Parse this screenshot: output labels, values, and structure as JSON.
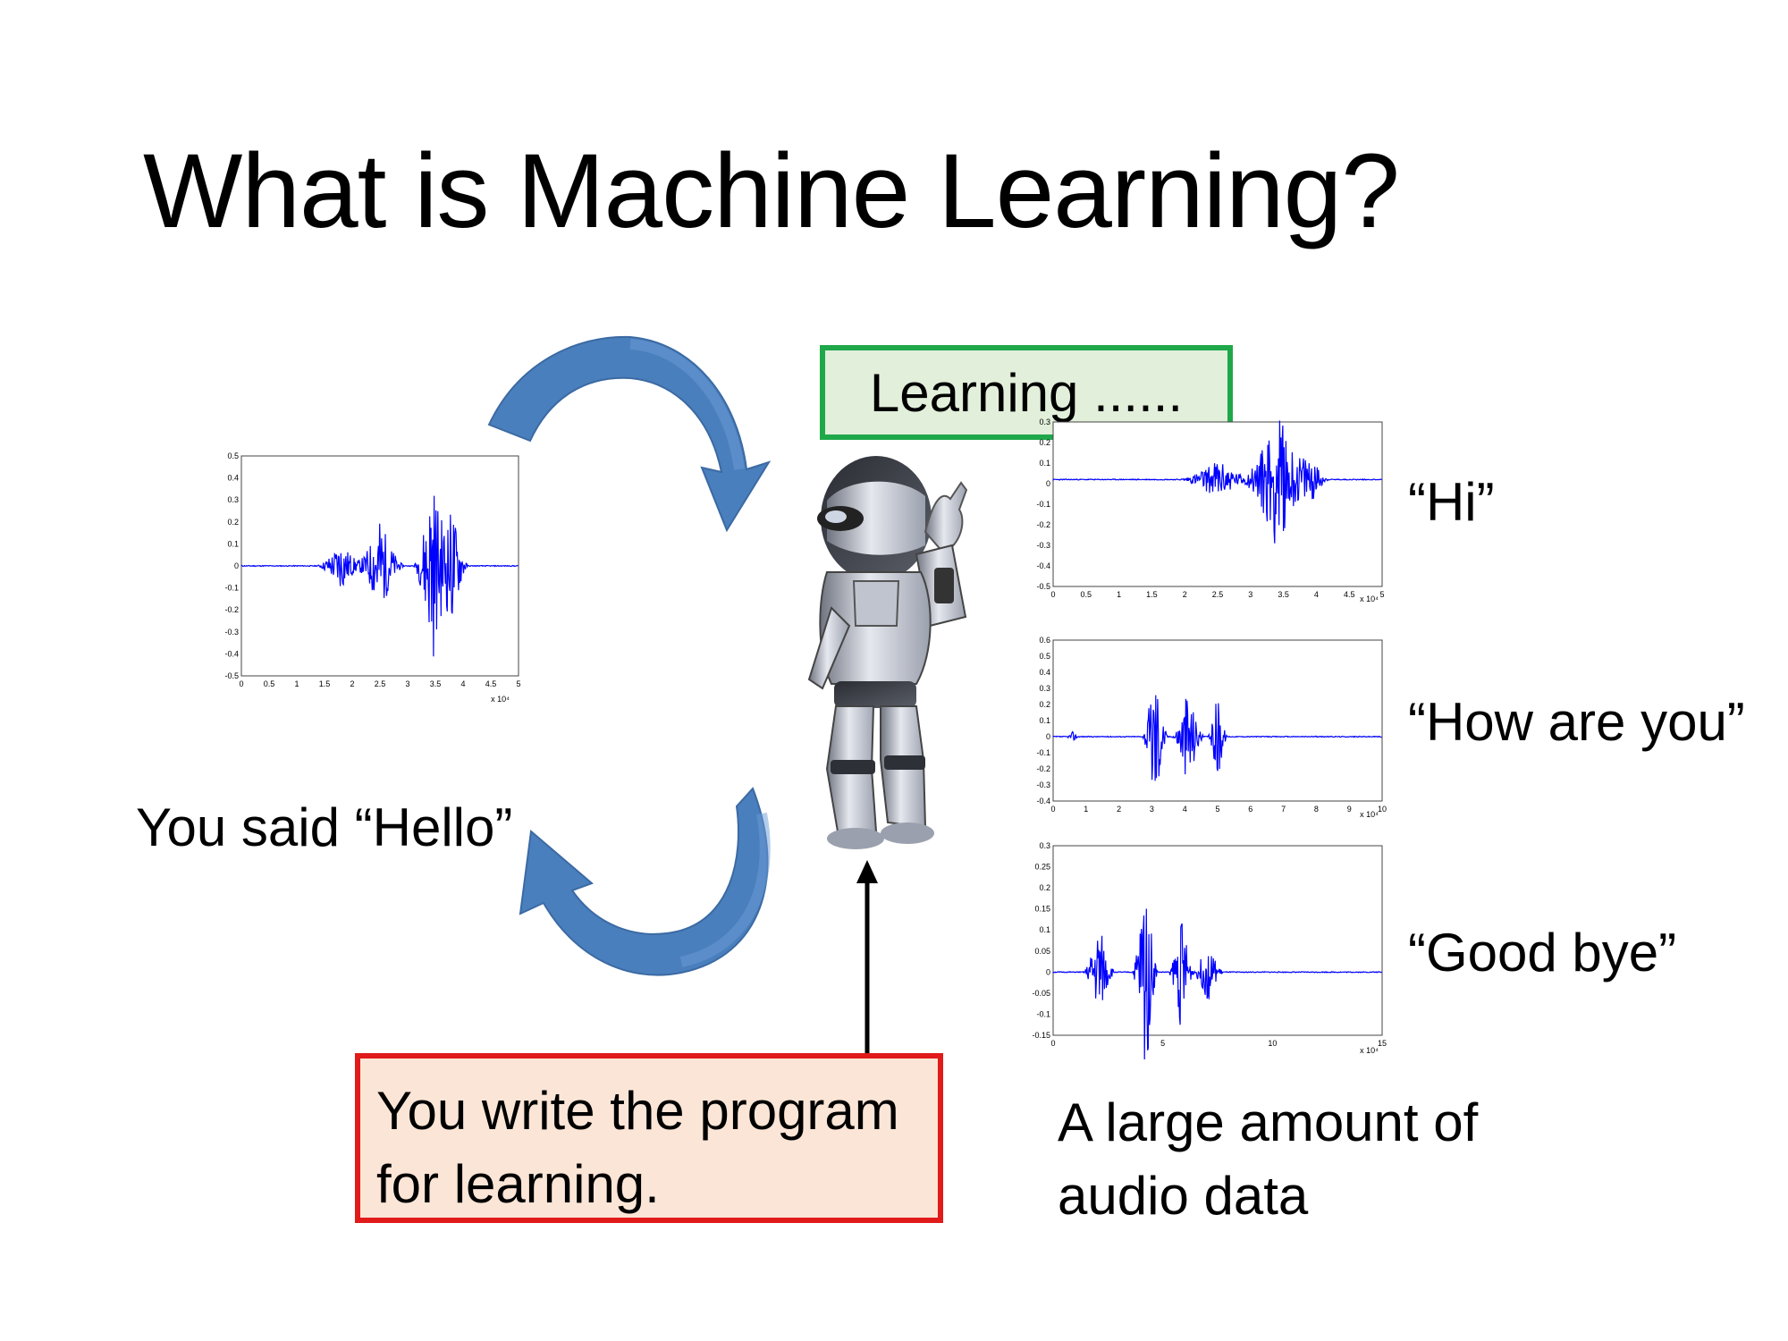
{
  "slide": {
    "title": "What is Machine Learning?",
    "you_said": "You said “Hello”",
    "learning_box": "Learning ......",
    "program_box": [
      "You write the program",
      "for learning."
    ],
    "data_note": [
      "A large amount of",
      "audio data"
    ]
  },
  "samples": [
    {
      "label": "“Hi”"
    },
    {
      "label": "“How are you”"
    },
    {
      "label": "“Good bye”"
    }
  ],
  "plots": {
    "hello": {
      "y_ticks": [
        "0.5",
        "0.4",
        "0.3",
        "0.2",
        "0.1",
        "0",
        "-0.1",
        "-0.2",
        "-0.3",
        "-0.4",
        "-0.5"
      ],
      "x_ticks": [
        "0",
        "0.5",
        "1",
        "1.5",
        "2",
        "2.5",
        "3",
        "3.5",
        "4",
        "4.5",
        "5"
      ],
      "x_mult": "x 10⁴"
    },
    "hi": {
      "y_ticks": [
        "0.3",
        "0.2",
        "0.1",
        "0",
        "-0.1",
        "-0.2",
        "-0.3",
        "-0.4",
        "-0.5"
      ],
      "x_ticks": [
        "0",
        "0.5",
        "1",
        "1.5",
        "2",
        "2.5",
        "3",
        "3.5",
        "4",
        "4.5",
        "5"
      ],
      "x_mult": "x 10⁴"
    },
    "how": {
      "y_ticks": [
        "0.6",
        "0.5",
        "0.4",
        "0.3",
        "0.2",
        "0.1",
        "0",
        "-0.1",
        "-0.2",
        "-0.3",
        "-0.4"
      ],
      "x_ticks": [
        "0",
        "1",
        "2",
        "3",
        "4",
        "5",
        "6",
        "7",
        "8",
        "9",
        "10"
      ],
      "x_mult": "x 10⁴"
    },
    "bye": {
      "y_ticks": [
        "0.3",
        "0.25",
        "0.2",
        "0.15",
        "0.1",
        "0.05",
        "0",
        "-0.05",
        "-0.1",
        "-0.15"
      ],
      "x_ticks": [
        "0",
        "5",
        "10",
        "15"
      ],
      "x_mult": "x 10⁴"
    }
  },
  "colors": {
    "arrow_blue": "#4a7fbd",
    "wave_blue": "#0000ff",
    "green_border": "#1fa84a",
    "red_border": "#e11a1a"
  }
}
